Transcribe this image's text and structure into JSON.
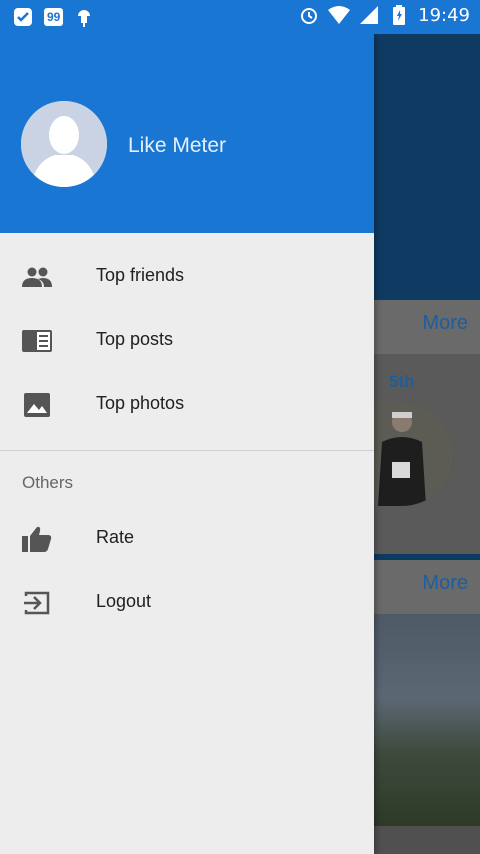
{
  "status_bar": {
    "time": "19:49",
    "badge": "99"
  },
  "drawer": {
    "profile_name": "Like Meter",
    "menu_items": [
      {
        "label": "Top friends",
        "icon": "people-icon"
      },
      {
        "label": "Top posts",
        "icon": "newspaper-icon"
      },
      {
        "label": "Top photos",
        "icon": "image-icon"
      }
    ],
    "section_title": "Others",
    "other_items": [
      {
        "label": "Rate",
        "icon": "thumb-up-icon"
      },
      {
        "label": "Logout",
        "icon": "logout-icon"
      }
    ]
  },
  "background": {
    "more_label_1": "More",
    "rank": "5th",
    "more_label_2": "More"
  },
  "colors": {
    "primary": "#1976d2",
    "drawer_bg": "#ededed",
    "link": "#1e5e9c"
  }
}
